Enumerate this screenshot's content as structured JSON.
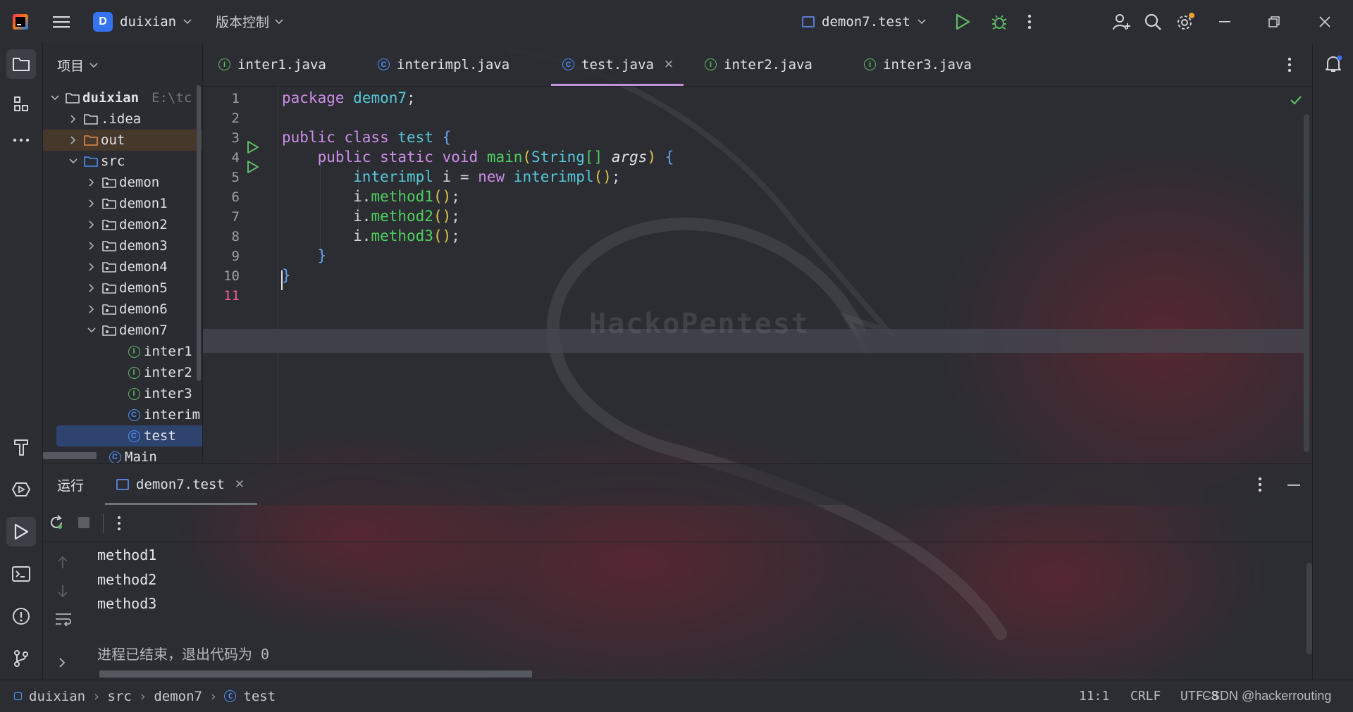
{
  "titlebar": {
    "project_badge": "D",
    "project_name": "duixian",
    "vcs_label": "版本控制",
    "run_config": "demon7.test"
  },
  "project_panel": {
    "header": "项目",
    "root_name": "duixian",
    "root_path_hint": "E:\\tc",
    "items": [
      {
        "label": ".idea"
      },
      {
        "label": "out"
      },
      {
        "label": "src"
      },
      {
        "label": "demon"
      },
      {
        "label": "demon1"
      },
      {
        "label": "demon2"
      },
      {
        "label": "demon3"
      },
      {
        "label": "demon4"
      },
      {
        "label": "demon5"
      },
      {
        "label": "demon6"
      },
      {
        "label": "demon7"
      },
      {
        "label": "inter1",
        "badge": "I"
      },
      {
        "label": "inter2",
        "badge": "I"
      },
      {
        "label": "inter3",
        "badge": "I"
      },
      {
        "label": "interim",
        "badge": "C"
      },
      {
        "label": "test",
        "badge": "C"
      },
      {
        "label": "Main",
        "badge": "C"
      }
    ]
  },
  "tabs": [
    {
      "label": "inter1.java",
      "badge": "I"
    },
    {
      "label": "interimpl.java",
      "badge": "C"
    },
    {
      "label": "test.java",
      "badge": "C"
    },
    {
      "label": "inter2.java",
      "badge": "I"
    },
    {
      "label": "inter3.java",
      "badge": "I"
    }
  ],
  "editor": {
    "line_numbers": [
      "1",
      "2",
      "3",
      "4",
      "5",
      "6",
      "7",
      "8",
      "9",
      "10",
      "11"
    ],
    "code": {
      "package_kw": "package",
      "package_name": "demon7",
      "class_decl": "public class",
      "class_name": "test",
      "main_mods": "public static void",
      "main_name": "main",
      "main_param_type": "String",
      "main_param": "args",
      "var_type": "interimpl",
      "var_name": "i",
      "new_kw": "new",
      "ctor": "interimpl",
      "calls": [
        "method1",
        "method2",
        "method3"
      ]
    },
    "watermark": "HackoPentest"
  },
  "run_panel": {
    "title": "运行",
    "tab_label": "demon7.test",
    "output": [
      "method1",
      "method2",
      "method3"
    ],
    "exit_message": "进程已结束，退出代码为 0"
  },
  "statusbar": {
    "breadcrumb": [
      "duixian",
      "src",
      "demon7",
      "test"
    ],
    "position": "11:1",
    "line_sep": "CRLF",
    "encoding": "UTF-8",
    "csdn_watermark": "CSDN @hackerrouting"
  }
}
